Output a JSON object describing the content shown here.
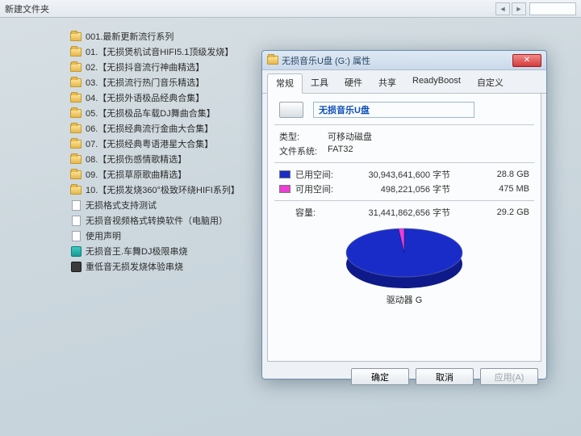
{
  "explorer": {
    "title": "新建文件夹",
    "items": [
      {
        "icon": "folder",
        "label": "001.最新更新流行系列"
      },
      {
        "icon": "folder",
        "label": "01.【无损煲机试音HIFI5.1顶级发烧】"
      },
      {
        "icon": "folder",
        "label": "02.【无损抖音流行神曲精选】"
      },
      {
        "icon": "folder",
        "label": "03.【无损流行热门音乐精选】"
      },
      {
        "icon": "folder",
        "label": "04.【无损外语极品经典合集】"
      },
      {
        "icon": "folder",
        "label": "05.【无损极品车载DJ舞曲合集】"
      },
      {
        "icon": "folder",
        "label": "06.【无损经典流行金曲大合集】"
      },
      {
        "icon": "folder",
        "label": "07.【无损经典粤语港星大合集】"
      },
      {
        "icon": "folder",
        "label": "08.【无损伤感情歌精选】"
      },
      {
        "icon": "folder",
        "label": "09.【无损草原歌曲精选】"
      },
      {
        "icon": "folder",
        "label": "10.【无损发烧360°极致环绕HIFI系列】"
      },
      {
        "icon": "file",
        "label": "无损格式支持测试"
      },
      {
        "icon": "file",
        "label": "无损音视频格式转换软件（电脑用）"
      },
      {
        "icon": "file",
        "label": "使用声明"
      },
      {
        "icon": "app",
        "label": "无损音王.车舞DJ极限串烧"
      },
      {
        "icon": "dark",
        "label": "重低音无损发烧体验串烧"
      }
    ]
  },
  "dialog": {
    "title": "无损音乐U盘 (G:) 属性",
    "tabs": [
      "常规",
      "工具",
      "硬件",
      "共享",
      "ReadyBoost",
      "自定义"
    ],
    "active_tab": 0,
    "drive_name": "无损音乐U盘",
    "type_label": "类型:",
    "type_value": "可移动磁盘",
    "fs_label": "文件系统:",
    "fs_value": "FAT32",
    "used_label": "已用空间:",
    "used_bytes": "30,943,641,600 字节",
    "used_human": "28.8 GB",
    "free_label": "可用空间:",
    "free_bytes": "498,221,056 字节",
    "free_human": "475 MB",
    "cap_label": "容量:",
    "cap_bytes": "31,441,862,656 字节",
    "cap_human": "29.2 GB",
    "drive_letter_label": "驱动器 G",
    "buttons": {
      "ok": "确定",
      "cancel": "取消",
      "apply": "应用(A)"
    }
  },
  "chart_data": {
    "type": "pie",
    "title": "驱动器 G",
    "series": [
      {
        "name": "已用空间",
        "value": 30943641600,
        "human": "28.8 GB",
        "color": "#1a2cc8"
      },
      {
        "name": "可用空间",
        "value": 498221056,
        "human": "475 MB",
        "color": "#ea3ed4"
      }
    ]
  }
}
